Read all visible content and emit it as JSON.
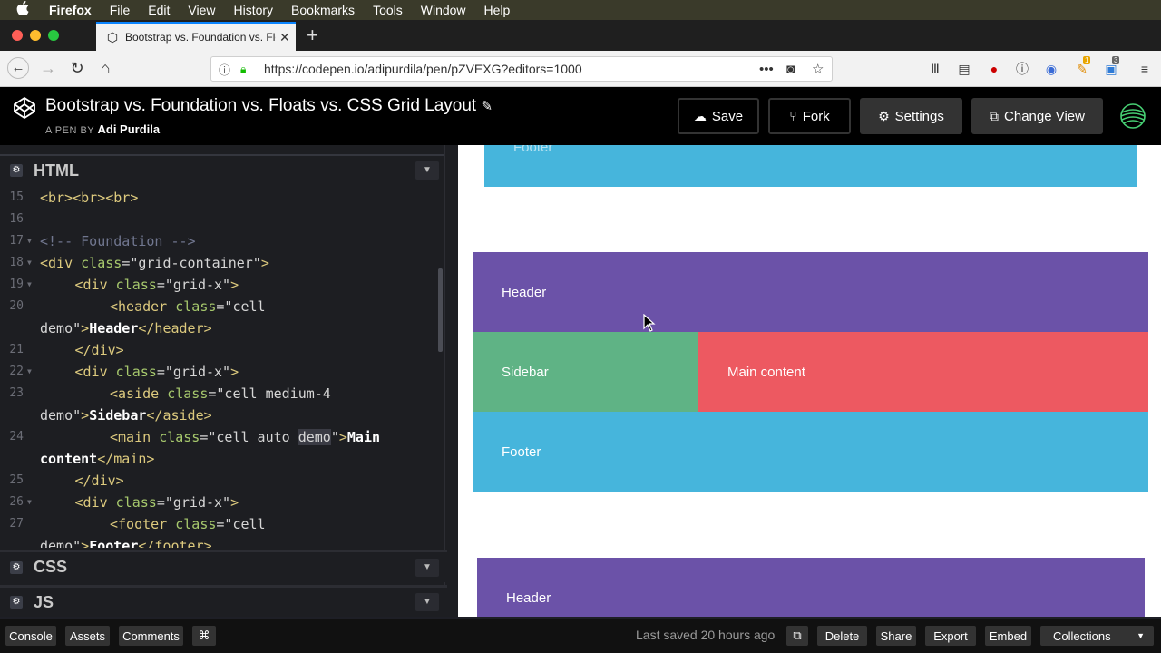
{
  "menubar": {
    "app": "Firefox",
    "items": [
      "File",
      "Edit",
      "View",
      "History",
      "Bookmarks",
      "Tools",
      "Window",
      "Help"
    ]
  },
  "browser": {
    "tab_title": "Bootstrap vs. Foundation vs. Flo",
    "url": "https://codepen.io/adipurdila/pen/pZVEXG?editors=1000",
    "badge_counts": [
      "1",
      "3"
    ]
  },
  "pen": {
    "title": "Bootstrap vs. Foundation vs. Floats vs. CSS Grid Layout",
    "by_prefix": "A PEN BY",
    "author": "Adi Purdila"
  },
  "header_buttons": {
    "save": "Save",
    "fork": "Fork",
    "settings": "Settings",
    "change_view": "Change View"
  },
  "panes": {
    "html": "HTML",
    "css": "CSS",
    "js": "JS"
  },
  "code_lines": [
    {
      "n": "15",
      "fold": false,
      "indent": 0,
      "segs": [
        [
          "t-tag",
          "<br><br><br>"
        ]
      ]
    },
    {
      "n": "16",
      "fold": false,
      "indent": 0,
      "segs": []
    },
    {
      "n": "17",
      "fold": true,
      "indent": 0,
      "segs": [
        [
          "t-com",
          "<!-- Foundation -->"
        ]
      ]
    },
    {
      "n": "18",
      "fold": true,
      "indent": 0,
      "segs": [
        [
          "t-tag",
          "<div "
        ],
        [
          "t-attr",
          "class"
        ],
        [
          "t-str",
          "=\"grid-container\""
        ],
        [
          "t-tag",
          ">"
        ]
      ]
    },
    {
      "n": "19",
      "fold": true,
      "indent": 1,
      "segs": [
        [
          "t-tag",
          "<div "
        ],
        [
          "t-attr",
          "class"
        ],
        [
          "t-str",
          "=\"grid-x\""
        ],
        [
          "t-tag",
          ">"
        ]
      ]
    },
    {
      "n": "20",
      "fold": false,
      "indent": 2,
      "segs": [
        [
          "t-tag",
          "<header "
        ],
        [
          "t-attr",
          "class"
        ],
        [
          "t-str",
          "=\"cell"
        ]
      ]
    },
    {
      "n": "",
      "fold": false,
      "indent": 0,
      "segs": [
        [
          "t-str",
          "demo\""
        ],
        [
          "t-tag",
          ">"
        ],
        [
          "t-txt",
          "Header"
        ],
        [
          "t-tag",
          "</header>"
        ]
      ]
    },
    {
      "n": "21",
      "fold": false,
      "indent": 1,
      "segs": [
        [
          "t-tag",
          "</div>"
        ]
      ]
    },
    {
      "n": "22",
      "fold": true,
      "indent": 1,
      "segs": [
        [
          "t-tag",
          "<div "
        ],
        [
          "t-attr",
          "class"
        ],
        [
          "t-str",
          "=\"grid-x\""
        ],
        [
          "t-tag",
          ">"
        ]
      ]
    },
    {
      "n": "23",
      "fold": false,
      "indent": 2,
      "segs": [
        [
          "t-tag",
          "<aside "
        ],
        [
          "t-attr",
          "class"
        ],
        [
          "t-str",
          "=\"cell medium-4"
        ]
      ]
    },
    {
      "n": "",
      "fold": false,
      "indent": 0,
      "segs": [
        [
          "t-str",
          "demo\""
        ],
        [
          "t-tag",
          ">"
        ],
        [
          "t-txt",
          "Sidebar"
        ],
        [
          "t-tag",
          "</aside>"
        ]
      ]
    },
    {
      "n": "24",
      "fold": false,
      "indent": 2,
      "segs": [
        [
          "t-tag",
          "<main "
        ],
        [
          "t-attr",
          "class"
        ],
        [
          "t-str",
          "=\"cell auto "
        ],
        [
          "t-hl",
          "demo"
        ],
        [
          "t-str",
          "\""
        ],
        [
          "t-tag",
          ">"
        ],
        [
          "t-txt",
          "Main"
        ]
      ]
    },
    {
      "n": "",
      "fold": false,
      "indent": 0,
      "segs": [
        [
          "t-txt",
          "content"
        ],
        [
          "t-tag",
          "</main>"
        ]
      ]
    },
    {
      "n": "25",
      "fold": false,
      "indent": 1,
      "segs": [
        [
          "t-tag",
          "</div>"
        ]
      ]
    },
    {
      "n": "26",
      "fold": true,
      "indent": 1,
      "segs": [
        [
          "t-tag",
          "<div "
        ],
        [
          "t-attr",
          "class"
        ],
        [
          "t-str",
          "=\"grid-x\""
        ],
        [
          "t-tag",
          ">"
        ]
      ]
    },
    {
      "n": "27",
      "fold": false,
      "indent": 2,
      "segs": [
        [
          "t-tag",
          "<footer "
        ],
        [
          "t-attr",
          "class"
        ],
        [
          "t-str",
          "=\"cell"
        ]
      ]
    },
    {
      "n": "",
      "fold": false,
      "indent": 0,
      "segs": [
        [
          "t-str",
          "demo\""
        ],
        [
          "t-tag",
          ">"
        ],
        [
          "t-txt",
          "Footer"
        ],
        [
          "t-tag",
          "</footer>"
        ]
      ]
    }
  ],
  "preview": {
    "footer_top_cut": "Footer",
    "header": "Header",
    "sidebar": "Sidebar",
    "main": "Main content",
    "footer": "Footer",
    "header2": "Header"
  },
  "colors": {
    "header": "#6b52a8",
    "sidebar": "#5fb385",
    "main": "#ed5961",
    "footer": "#46b5dc"
  },
  "footer_bar": {
    "console": "Console",
    "assets": "Assets",
    "comments": "Comments",
    "shortcut": "⌘",
    "last_saved": "Last saved 20 hours ago",
    "delete": "Delete",
    "share": "Share",
    "export": "Export",
    "embed": "Embed",
    "collections": "Collections"
  }
}
